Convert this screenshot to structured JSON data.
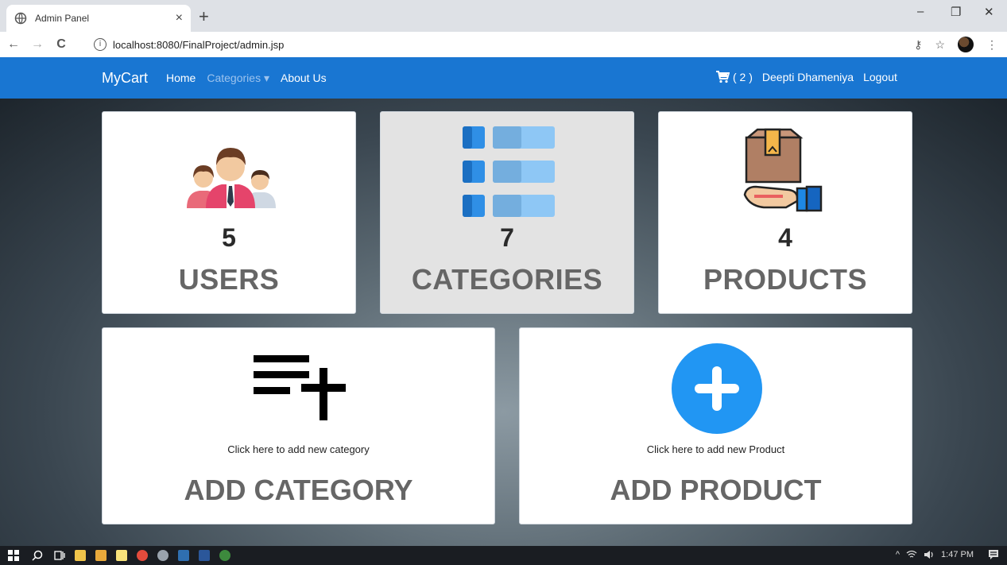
{
  "browser": {
    "tab_title": "Admin Panel",
    "tab_close": "×",
    "new_tab": "+",
    "url": "localhost:8080/FinalProject/admin.jsp",
    "info_glyph": "i",
    "minimize": "–",
    "restore": "❐",
    "close": "✕",
    "back": "←",
    "forward": "→",
    "reload": "C",
    "key_glyph": "⚷",
    "star_glyph": "☆",
    "menu_glyph": "⋮"
  },
  "navbar": {
    "brand": "MyCart",
    "links": [
      "Home",
      "Categories ▾",
      "About Us"
    ],
    "cart_count": "( 2 )",
    "user": "Deepti Dhameniya",
    "logout": "Logout",
    "color": "#1976d2"
  },
  "cards": {
    "users": {
      "count": "5",
      "label": "USERS",
      "icon": "users-icon"
    },
    "categories": {
      "count": "7",
      "label": "CATEGORIES",
      "icon": "list-grid-icon"
    },
    "products": {
      "count": "4",
      "label": "PRODUCTS",
      "icon": "box-in-hand-icon"
    },
    "add_category": {
      "hint": "Click here to add new category",
      "label": "ADD CATEGORY",
      "icon": "playlist-add-icon"
    },
    "add_product": {
      "hint": "Click here to add new Product",
      "label": "ADD PRODUCT",
      "icon": "plus-circle-icon"
    }
  },
  "taskbar": {
    "time": "1:47 PM",
    "tray_chevron": "^"
  }
}
